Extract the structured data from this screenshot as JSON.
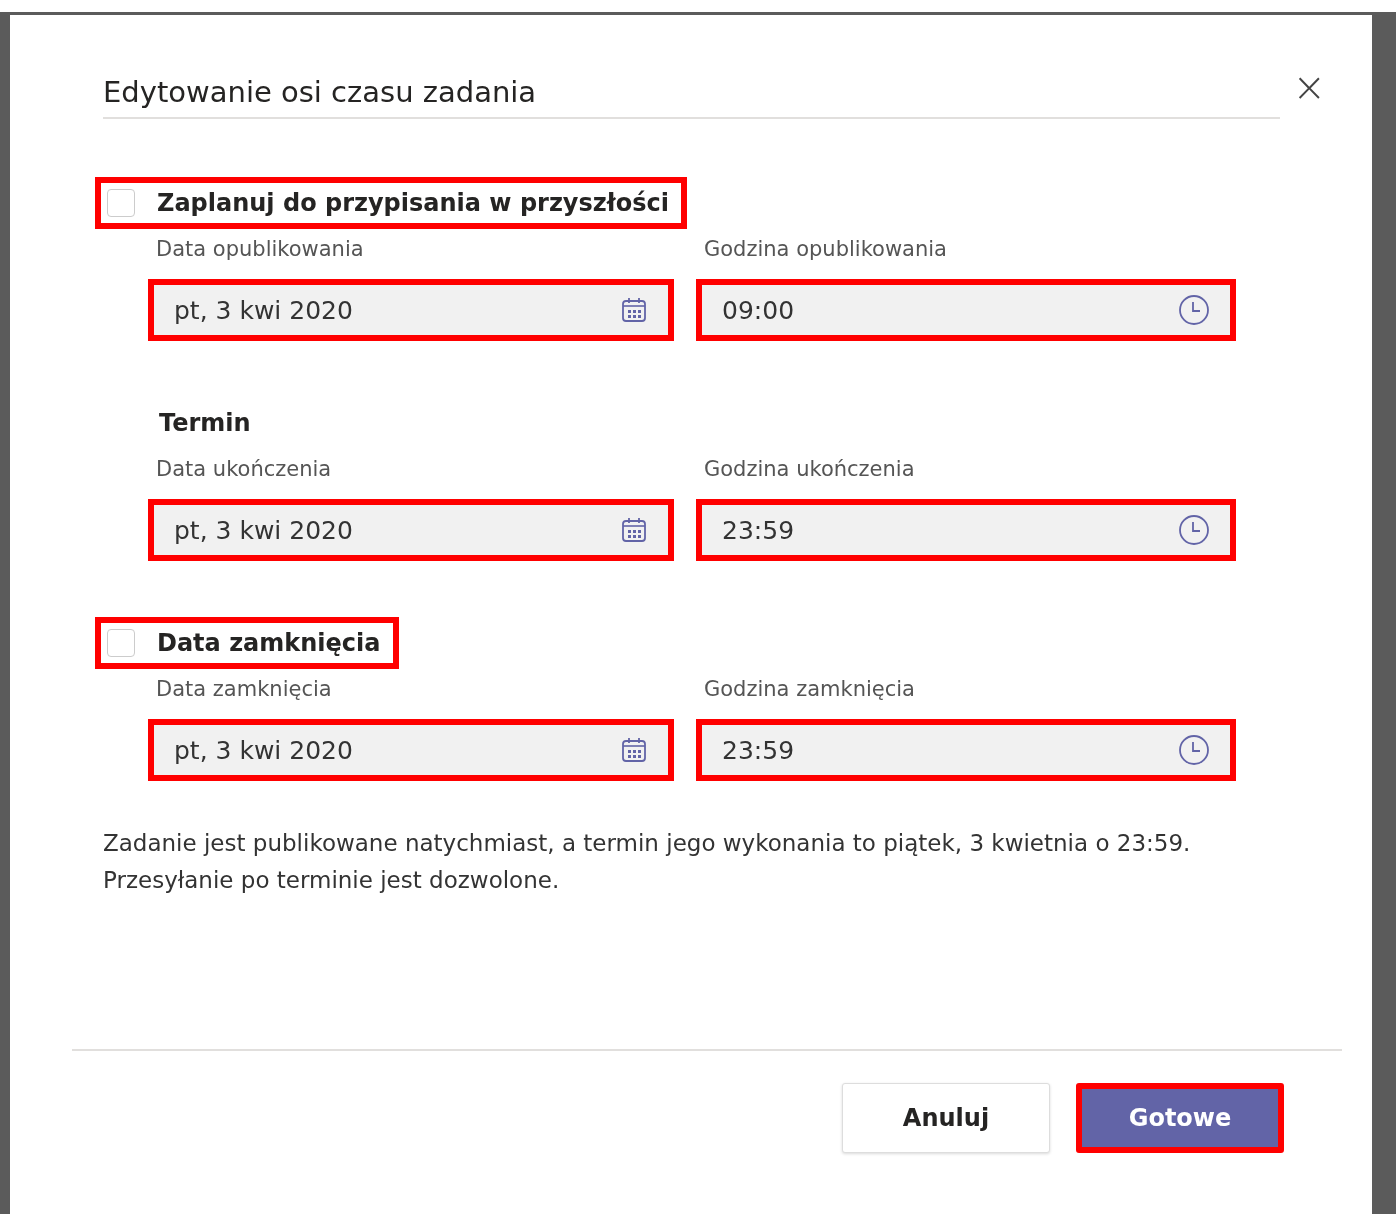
{
  "dialog": {
    "title": "Edytowanie osi czasu zadania",
    "close": "×"
  },
  "sections": [
    {
      "heading": "Zaplanuj do przypisania w przyszłości",
      "kind": "checkbox",
      "checked": false,
      "highlighted": true,
      "fields": [
        {
          "label": "Data opublikowania",
          "value": "pt, 3 kwi 2020",
          "kind": "date",
          "highlighted": true
        },
        {
          "label": "Godzina opublikowania",
          "value": "09:00",
          "kind": "time",
          "highlighted": true
        }
      ]
    },
    {
      "heading": "Termin",
      "kind": "plain",
      "highlighted": false,
      "fields": [
        {
          "label": "Data ukończenia",
          "value": "pt, 3 kwi 2020",
          "kind": "date",
          "highlighted": true
        },
        {
          "label": "Godzina ukończenia",
          "value": "23:59",
          "kind": "time",
          "highlighted": true
        }
      ]
    },
    {
      "heading": "Data zamknięcia",
      "kind": "checkbox",
      "checked": false,
      "highlighted": true,
      "fields": [
        {
          "label": "Data zamknięcia",
          "value": "pt, 3 kwi 2020",
          "kind": "date",
          "highlighted": true
        },
        {
          "label": "Godzina zamknięcia",
          "value": "23:59",
          "kind": "time",
          "highlighted": true
        }
      ]
    }
  ],
  "summary": "Zadanie jest publikowane natychmiast, a termin jego wykonania to piątek, 3 kwietnia o 23:59. Przesyłanie po terminie jest dozwolone.",
  "buttons": [
    {
      "label": "Anuluj",
      "kind": "secondary",
      "highlighted": false
    },
    {
      "label": "Gotowe",
      "kind": "primary",
      "highlighted": true
    }
  ]
}
